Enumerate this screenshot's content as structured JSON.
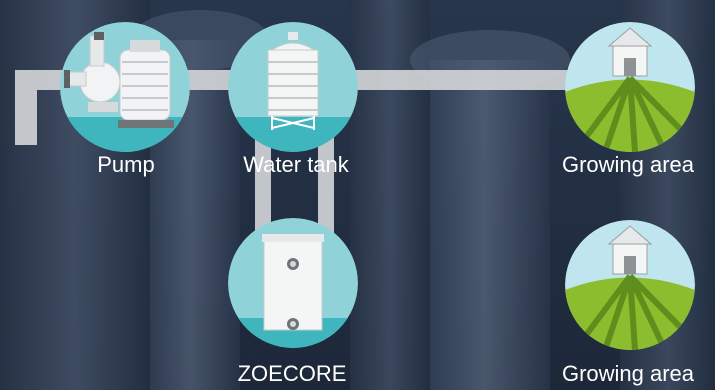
{
  "labels": {
    "pump": "Pump",
    "water_tank": "Water tank",
    "growing_area_top": "Growing area",
    "zoecore": "ZOECORE",
    "growing_area_bottom": "Growing area"
  },
  "colors": {
    "circle_bg": "#8fd3d8",
    "circle_water": "#3fb6bd",
    "pipe": "#d0d3d6",
    "field_green": "#8bbd2e",
    "field_dark": "#5f8e1c",
    "sky": "#bfe6ee"
  },
  "icons": {
    "pump": "pump-icon",
    "water_tank": "water-tank-icon",
    "growing_area": "farmhouse-field-icon",
    "zoecore": "zoecore-unit-icon"
  }
}
